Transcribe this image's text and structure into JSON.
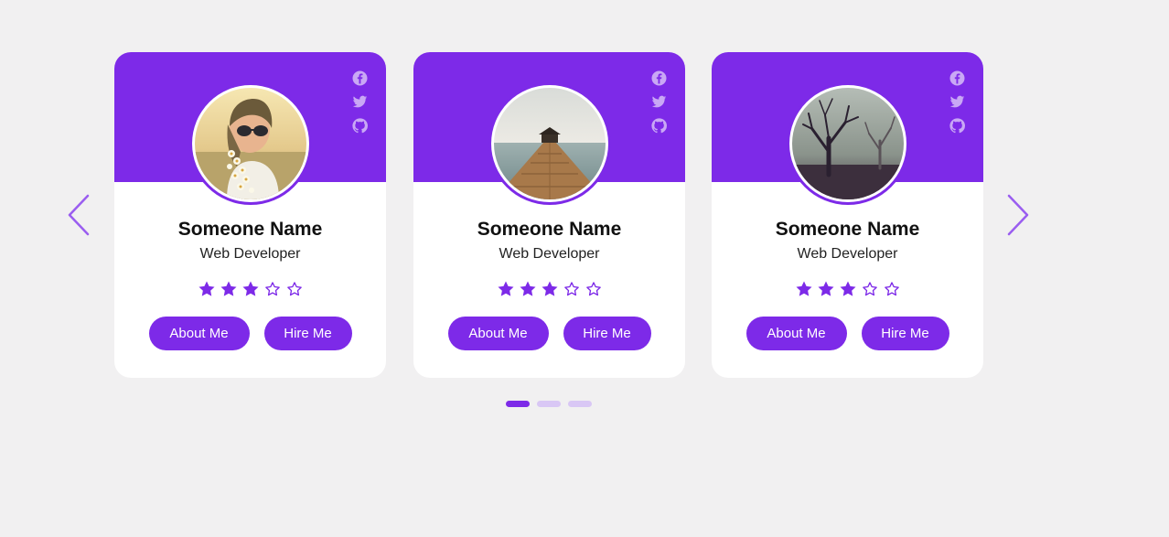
{
  "colors": {
    "accent": "#7d2ae8",
    "accent_light": "#d9c7f5",
    "social_icon": "#c9a8f5",
    "background": "#f1f0f1",
    "card": "#ffffff"
  },
  "navigation": {
    "prev_icon": "chevron-left-icon",
    "next_icon": "chevron-right-icon"
  },
  "cards": [
    {
      "name": "Someone Name",
      "job": "Web Developer",
      "rating": 3,
      "rating_max": 5,
      "social": [
        "facebook-icon",
        "twitter-icon",
        "github-icon"
      ],
      "photo": "woman-with-sunglasses-and-flowers",
      "buttons": {
        "about": "About Me",
        "hire": "Hire Me"
      }
    },
    {
      "name": "Someone Name",
      "job": "Web Developer",
      "rating": 3,
      "rating_max": 5,
      "social": [
        "facebook-icon",
        "twitter-icon",
        "github-icon"
      ],
      "photo": "wooden-pier-on-sea",
      "buttons": {
        "about": "About Me",
        "hire": "Hire Me"
      }
    },
    {
      "name": "Someone Name",
      "job": "Web Developer",
      "rating": 3,
      "rating_max": 5,
      "social": [
        "facebook-icon",
        "twitter-icon",
        "github-icon"
      ],
      "photo": "bare-trees-in-fog",
      "buttons": {
        "about": "About Me",
        "hire": "Hire Me"
      }
    }
  ],
  "pagination": {
    "total": 3,
    "active": 1
  }
}
